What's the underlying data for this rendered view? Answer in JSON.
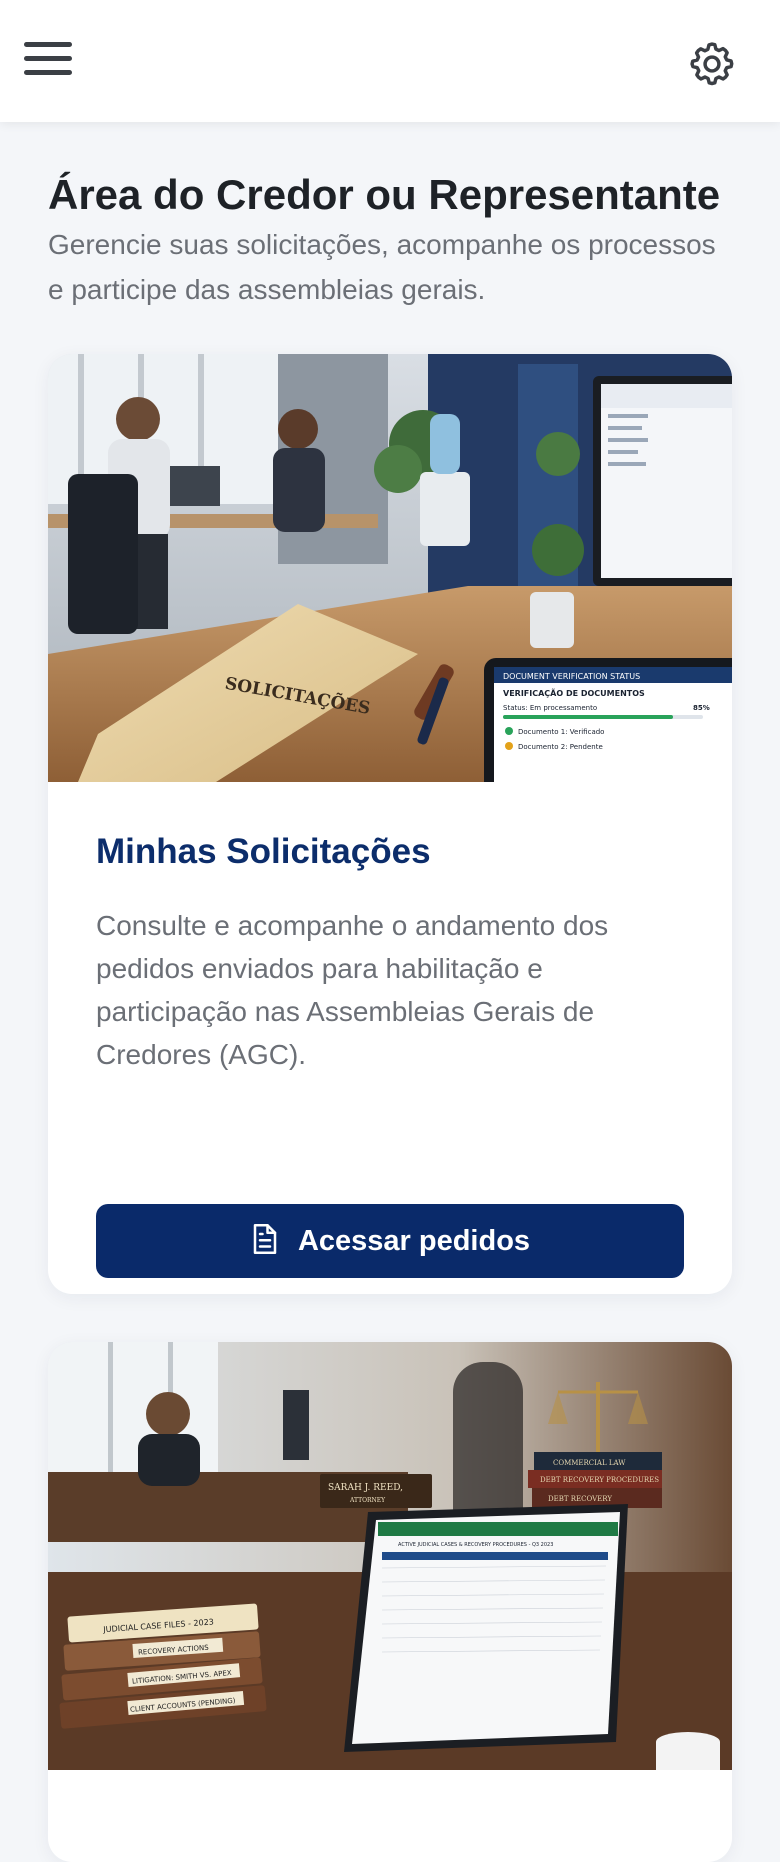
{
  "header": {
    "menu_icon": "hamburger-menu-icon",
    "settings_icon": "gear-icon"
  },
  "page": {
    "title": "Área do Credor ou Representante",
    "subtitle": "Gerencie suas solicitações, acompanhe os processos e participe das assembleias gerais."
  },
  "cards": [
    {
      "image": {
        "folder_label": "SOLICITAÇÕES",
        "tablet_header": "DOCUMENT VERIFICATION STATUS",
        "tablet_title": "VERIFICAÇÃO DE DOCUMENTOS",
        "tablet_status": "Status: Em processamento",
        "tablet_percent": "85%",
        "tablet_doc1": "Documento 1: Verificado",
        "tablet_doc2": "Documento 2: Pendente"
      },
      "title": "Minhas Solicitações",
      "description": "Consulte e acompanhe o andamento dos pedidos enviados para habilitação e participação nas Assembleias Gerais de Credores (AGC).",
      "button_label": "Acessar pedidos",
      "button_icon": "document-icon"
    },
    {
      "image": {
        "nameplate_name": "SARAH J. REED,",
        "nameplate_title": "ATTORNEY",
        "book_1": "COMMERCIAL LAW",
        "book_2": "DEBT RECOVERY PROCEDURES",
        "book_3": "DEBT RECOVERY",
        "file_1": "JUDICIAL CASE FILES - 2023",
        "file_2": "RECOVERY ACTIONS",
        "file_3": "LITIGATION: SMITH VS. APEX",
        "file_4": "CLIENT ACCOUNTS (PENDING)",
        "spreadsheet_title": "ACTIVE JUDICIAL CASES & RECOVERY PROCEDURES - Q3 2023"
      }
    }
  ],
  "colors": {
    "brand_navy": "#0a2a6a",
    "title_navy": "#0c2d6b",
    "background": "#f4f6f9"
  }
}
